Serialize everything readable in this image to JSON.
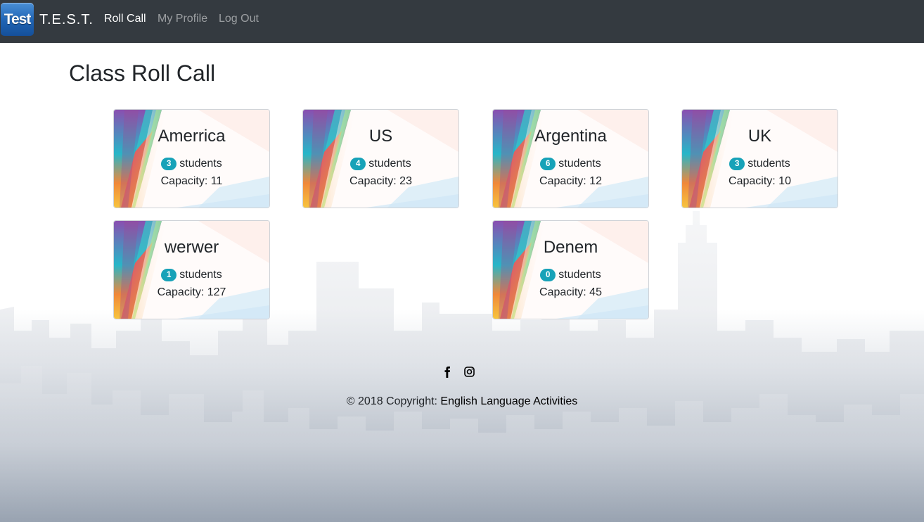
{
  "navbar": {
    "logo_text": "Test",
    "brand": "T.E.S.T.",
    "links": [
      {
        "label": "Roll Call",
        "active": true
      },
      {
        "label": "My Profile",
        "active": false
      },
      {
        "label": "Log Out",
        "active": false
      }
    ]
  },
  "page": {
    "title": "Class Roll Call"
  },
  "classes": [
    {
      "name": "Amerrica",
      "students": "3",
      "students_label": "students",
      "capacity": "Capacity: 11"
    },
    {
      "name": "US",
      "students": "4",
      "students_label": "students",
      "capacity": "Capacity: 23"
    },
    {
      "name": "Argentina",
      "students": "6",
      "students_label": "students",
      "capacity": "Capacity: 12"
    },
    {
      "name": "UK",
      "students": "3",
      "students_label": "students",
      "capacity": "Capacity: 10"
    },
    {
      "name": "werwer",
      "students": "1",
      "students_label": "students",
      "capacity": "Capacity: 127"
    },
    {
      "name": "Denem",
      "students": "0",
      "students_label": "students",
      "capacity": "Capacity: 45"
    }
  ],
  "footer": {
    "social": [
      "facebook-icon",
      "instagram-icon"
    ],
    "copyright": "© 2018 Copyright: ",
    "link_text": "English Language Activities"
  },
  "colors": {
    "navbar": "#343a40",
    "badge": "#17a2b8"
  }
}
